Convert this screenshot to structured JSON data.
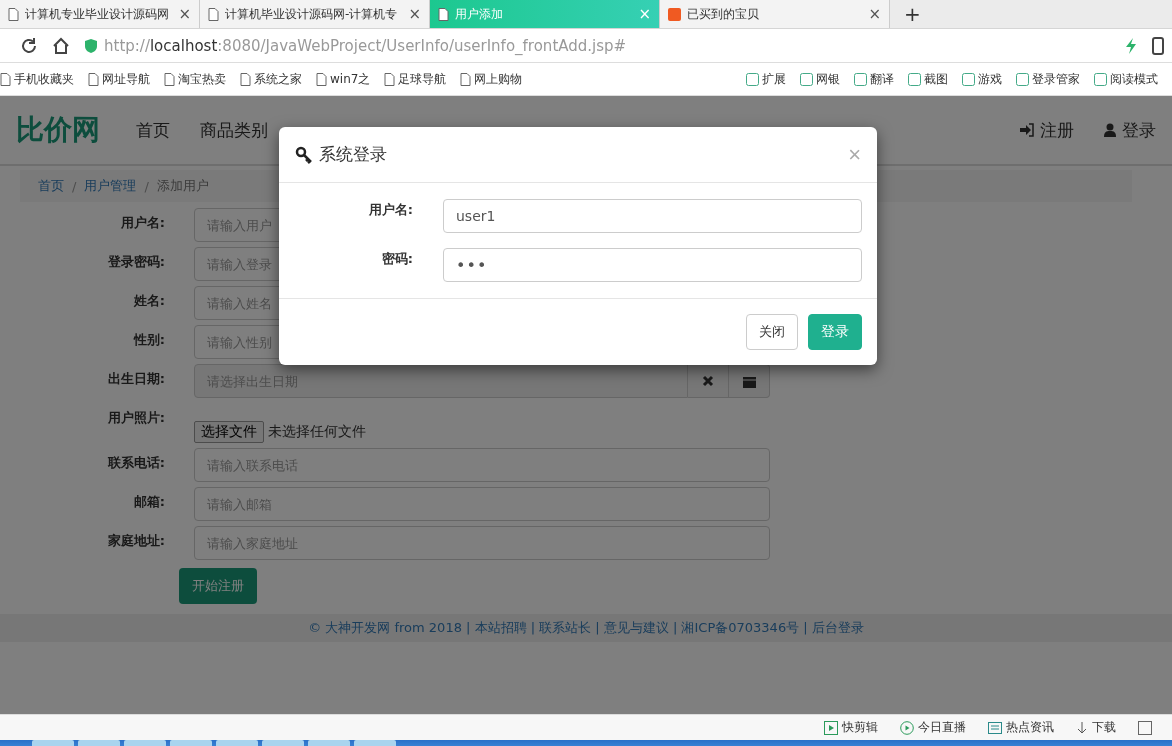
{
  "browser": {
    "tabs": [
      {
        "title": "计算机专业毕业设计源码网",
        "selected": false,
        "kind": "page"
      },
      {
        "title": "计算机毕业设计源码网-计算机专",
        "selected": false,
        "kind": "page"
      },
      {
        "title": "用户添加",
        "selected": true,
        "kind": "page"
      },
      {
        "title": "已买到的宝贝",
        "selected": false,
        "kind": "shop"
      }
    ],
    "tab_close": "×",
    "new_tab": "+",
    "address": "http://**localhost**:8080/JavaWebProject/UserInfo/userInfo_frontAdd.jsp#",
    "bookmarks": [
      "手机收藏夹",
      "网址导航",
      "淘宝热卖",
      "系统之家",
      "win7之",
      "足球导航",
      "网上购物"
    ],
    "tools": [
      "扩展",
      "网银",
      "翻译",
      "截图",
      "游戏",
      "登录管家",
      "阅读模式"
    ]
  },
  "site": {
    "logo": "比价网",
    "nav": [
      "首页",
      "商品类别"
    ],
    "header_links": [
      {
        "label": "注册",
        "kind": "register"
      },
      {
        "label": "登录",
        "kind": "login"
      }
    ],
    "breadcrumb_separator": "/",
    "breadcrumb": [
      {
        "label": "首页",
        "kind": "link"
      },
      {
        "label": "用户管理",
        "kind": "link"
      },
      {
        "label": "添加用户",
        "kind": "current"
      }
    ],
    "form": {
      "fields": [
        {
          "label": "用户名:",
          "kind": "text",
          "placeholder": "请输入用户"
        },
        {
          "label": "登录密码:",
          "kind": "text",
          "placeholder": "请输入登录"
        },
        {
          "label": "姓名:",
          "kind": "text",
          "placeholder": "请输入姓名"
        },
        {
          "label": "性别:",
          "kind": "text",
          "placeholder": "请输入性别"
        },
        {
          "label": "出生日期:",
          "kind": "date",
          "placeholder": "请选择出生日期"
        },
        {
          "label": "用户照片:",
          "kind": "file",
          "button": "选择文件",
          "status": "未选择任何文件"
        },
        {
          "label": "联系电话:",
          "kind": "text",
          "placeholder": "请输入联系电话"
        },
        {
          "label": "邮箱:",
          "kind": "text",
          "placeholder": "请输入邮箱"
        },
        {
          "label": "家庭地址:",
          "kind": "text",
          "placeholder": "请输入家庭地址"
        }
      ],
      "submit": "开始注册"
    },
    "footer": "© 大神开发网 from 2018 | 本站招聘 | 联系站长 | 意见与建议 | 湘ICP备0703346号 | 后台登录"
  },
  "dialog": {
    "title": "系统登录",
    "close": "×",
    "fields": [
      {
        "label": "用户名:",
        "kind": "text",
        "value": "user1"
      },
      {
        "label": "密码:",
        "kind": "password",
        "value": "•••"
      }
    ],
    "buttons": [
      {
        "label": "关闭",
        "kind": "default"
      },
      {
        "label": "登录",
        "kind": "primary"
      }
    ]
  },
  "status_bar": {
    "items": [
      {
        "label": "快剪辑",
        "kind": "clip"
      },
      {
        "label": "今日直播",
        "kind": "live"
      },
      {
        "label": "热点资讯",
        "kind": "news"
      },
      {
        "label": "下载",
        "kind": "download"
      }
    ]
  }
}
